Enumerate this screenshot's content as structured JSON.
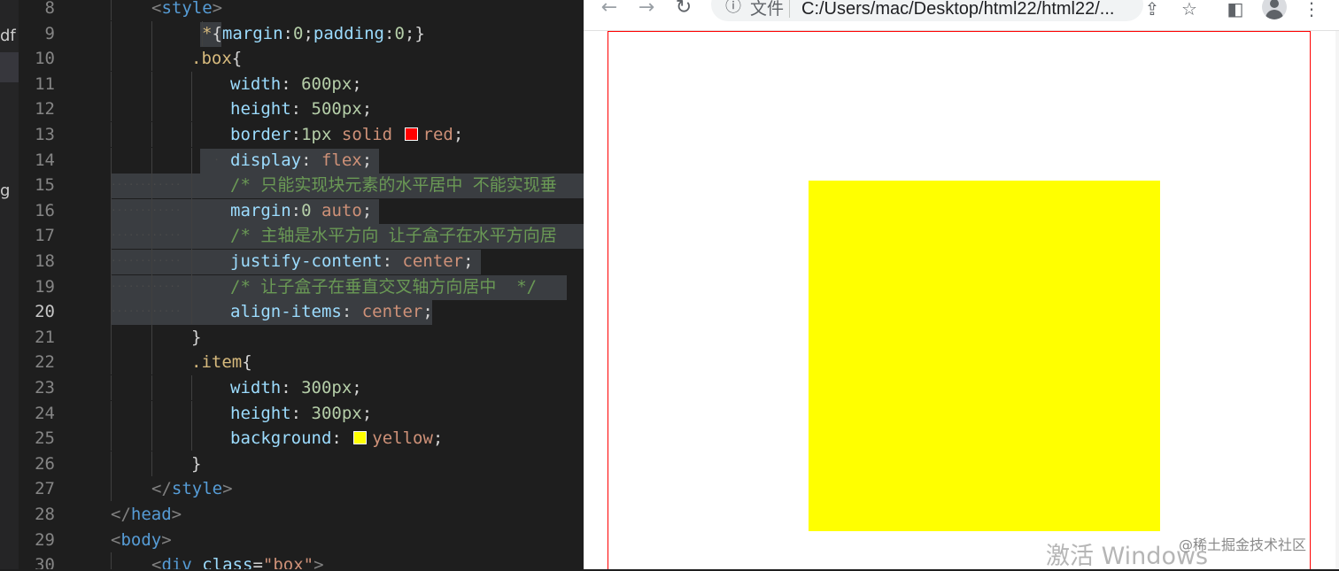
{
  "editor": {
    "sidebar_fragments": [
      "df",
      "g"
    ],
    "current_line": "20",
    "lines": [
      {
        "n": "8",
        "tokens": [
          [
            "t-punc",
            "<"
          ],
          [
            "t-tag",
            "style"
          ],
          [
            "t-punc",
            ">"
          ]
        ]
      },
      {
        "n": "9",
        "tokens": [
          [
            "t-sel",
            "*"
          ],
          [
            "t-text",
            "{"
          ],
          [
            "t-prop",
            "margin"
          ],
          [
            "t-text",
            ":"
          ],
          [
            "t-num",
            "0"
          ],
          [
            "t-text",
            ";"
          ],
          [
            "t-prop",
            "padding"
          ],
          [
            "t-text",
            ":"
          ],
          [
            "t-num",
            "0"
          ],
          [
            "t-text",
            ";}"
          ]
        ]
      },
      {
        "n": "10",
        "tokens": [
          [
            "t-sel",
            ".box"
          ],
          [
            "t-text",
            "{"
          ]
        ]
      },
      {
        "n": "11",
        "tokens": [
          [
            "t-prop",
            "width"
          ],
          [
            "t-text",
            ": "
          ],
          [
            "t-num",
            "600px"
          ],
          [
            "t-text",
            ";"
          ]
        ]
      },
      {
        "n": "12",
        "tokens": [
          [
            "t-prop",
            "height"
          ],
          [
            "t-text",
            ": "
          ],
          [
            "t-num",
            "500px"
          ],
          [
            "t-text",
            ";"
          ]
        ]
      },
      {
        "n": "13",
        "tokens": [
          [
            "t-prop",
            "border"
          ],
          [
            "t-text",
            ":"
          ],
          [
            "t-num",
            "1px"
          ],
          [
            "t-text",
            " "
          ],
          [
            "t-val",
            "solid"
          ],
          [
            "t-text",
            " "
          ],
          [
            "swatch",
            "#ff0000"
          ],
          [
            "t-val",
            "red"
          ],
          [
            "t-text",
            ";"
          ]
        ]
      },
      {
        "n": "14",
        "tokens": [
          [
            "t-prop",
            "display"
          ],
          [
            "t-text",
            ": "
          ],
          [
            "t-val",
            "flex"
          ],
          [
            "t-text",
            ";"
          ]
        ]
      },
      {
        "n": "15",
        "tokens": [
          [
            "t-com",
            "/* 只能实现块元素的水平居中 不能实现垂"
          ]
        ]
      },
      {
        "n": "16",
        "tokens": [
          [
            "t-prop",
            "margin"
          ],
          [
            "t-text",
            ":"
          ],
          [
            "t-num",
            "0"
          ],
          [
            "t-text",
            " "
          ],
          [
            "t-val",
            "auto"
          ],
          [
            "t-text",
            ";"
          ]
        ]
      },
      {
        "n": "17",
        "tokens": [
          [
            "t-com",
            "/* 主轴是水平方向 让子盒子在水平方向居"
          ]
        ]
      },
      {
        "n": "18",
        "tokens": [
          [
            "t-prop",
            "justify-content"
          ],
          [
            "t-text",
            ": "
          ],
          [
            "t-val",
            "center"
          ],
          [
            "t-text",
            ";"
          ]
        ]
      },
      {
        "n": "19",
        "tokens": [
          [
            "t-com",
            "/* 让子盒子在垂直交叉轴方向居中  */"
          ]
        ]
      },
      {
        "n": "20",
        "tokens": [
          [
            "t-prop",
            "align-items"
          ],
          [
            "t-text",
            ": "
          ],
          [
            "t-val",
            "center"
          ],
          [
            "t-text",
            ";"
          ]
        ]
      },
      {
        "n": "21",
        "tokens": [
          [
            "t-text",
            "}"
          ]
        ]
      },
      {
        "n": "22",
        "tokens": [
          [
            "t-sel",
            ".item"
          ],
          [
            "t-text",
            "{"
          ]
        ]
      },
      {
        "n": "23",
        "tokens": [
          [
            "t-prop",
            "width"
          ],
          [
            "t-text",
            ": "
          ],
          [
            "t-num",
            "300px"
          ],
          [
            "t-text",
            ";"
          ]
        ]
      },
      {
        "n": "24",
        "tokens": [
          [
            "t-prop",
            "height"
          ],
          [
            "t-text",
            ": "
          ],
          [
            "t-num",
            "300px"
          ],
          [
            "t-text",
            ";"
          ]
        ]
      },
      {
        "n": "25",
        "tokens": [
          [
            "t-prop",
            "background"
          ],
          [
            "t-text",
            ": "
          ],
          [
            "swatch",
            "#ffff00"
          ],
          [
            "t-val",
            "yellow"
          ],
          [
            "t-text",
            ";"
          ]
        ]
      },
      {
        "n": "26",
        "tokens": [
          [
            "t-text",
            "}"
          ]
        ]
      },
      {
        "n": "27",
        "tokens": [
          [
            "t-punc",
            "</"
          ],
          [
            "t-tag",
            "style"
          ],
          [
            "t-punc",
            ">"
          ]
        ]
      },
      {
        "n": "28",
        "tokens": [
          [
            "t-punc",
            "</"
          ],
          [
            "t-tag",
            "head"
          ],
          [
            "t-punc",
            ">"
          ]
        ]
      },
      {
        "n": "29",
        "tokens": [
          [
            "t-punc",
            "<"
          ],
          [
            "t-tag",
            "body"
          ],
          [
            "t-punc",
            ">"
          ]
        ]
      },
      {
        "n": "30",
        "tokens": [
          [
            "t-punc",
            "<"
          ],
          [
            "t-tag",
            "div"
          ],
          [
            "t-text",
            " "
          ],
          [
            "t-attr",
            "class"
          ],
          [
            "t-text",
            "="
          ],
          [
            "t-val",
            "\"box\""
          ],
          [
            "t-punc",
            ">"
          ]
        ]
      }
    ]
  },
  "browser": {
    "nav": {
      "back_icon": "arrow-back-icon",
      "forward_icon": "arrow-forward-icon",
      "reload_icon": "reload-icon"
    },
    "omnibox": {
      "info_icon": "info-icon",
      "label": "文件",
      "url": "C:/Users/mac/Desktop/html22/html22/..."
    },
    "toolbar_icons": [
      "share-icon",
      "bookmark-star-icon",
      "side-panel-icon",
      "profile-avatar-icon",
      "more-menu-icon"
    ],
    "page": {
      "box_border_color": "#ff0000",
      "item_color": "#ffff00"
    }
  },
  "overlay": {
    "watermark": "激活 Windows",
    "credit": "@稀土掘金技术社区"
  },
  "colors": {
    "editor_bg": "#1e1e1e",
    "selection": "#3a3d41",
    "comment": "#6a9955",
    "property": "#9cdcfe",
    "value": "#ce9178"
  }
}
